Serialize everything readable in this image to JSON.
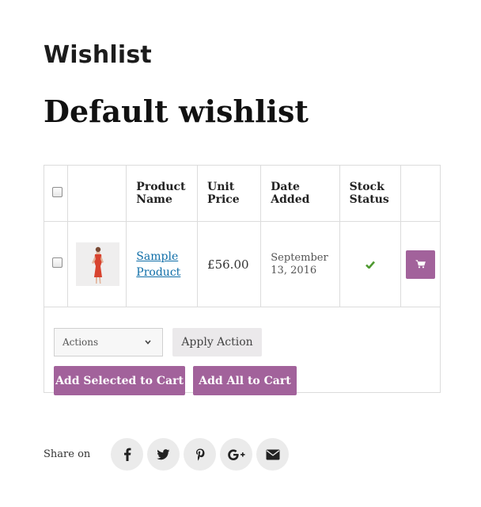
{
  "page": {
    "label": "Wishlist",
    "list_title": "Default wishlist"
  },
  "table": {
    "headers": {
      "product_name": [
        "Product",
        "Name"
      ],
      "unit_price": [
        "Unit",
        "Price"
      ],
      "date_added": [
        "Date",
        "Added"
      ],
      "stock_status": [
        "Stock",
        "Status"
      ]
    },
    "rows": [
      {
        "product": [
          "Sample",
          "Product"
        ],
        "price": "£56.00",
        "date": [
          "September",
          "13, 2016"
        ],
        "stock_icon": "checkmark-icon",
        "action_icon": "cart-icon"
      }
    ]
  },
  "actions": {
    "select_value": "Actions",
    "apply_label": "Apply Action",
    "add_selected_label": "Add Selected to Cart",
    "add_all_label": "Add All to Cart"
  },
  "share": {
    "label": "Share on",
    "networks": [
      "facebook-icon",
      "twitter-icon",
      "pinterest-icon",
      "google-plus-icon",
      "email-icon"
    ]
  },
  "colors": {
    "accent": "#a2629b",
    "link": "#0f6ea8",
    "in_stock": "#4f9a31",
    "social_bg": "#ebebeb"
  }
}
